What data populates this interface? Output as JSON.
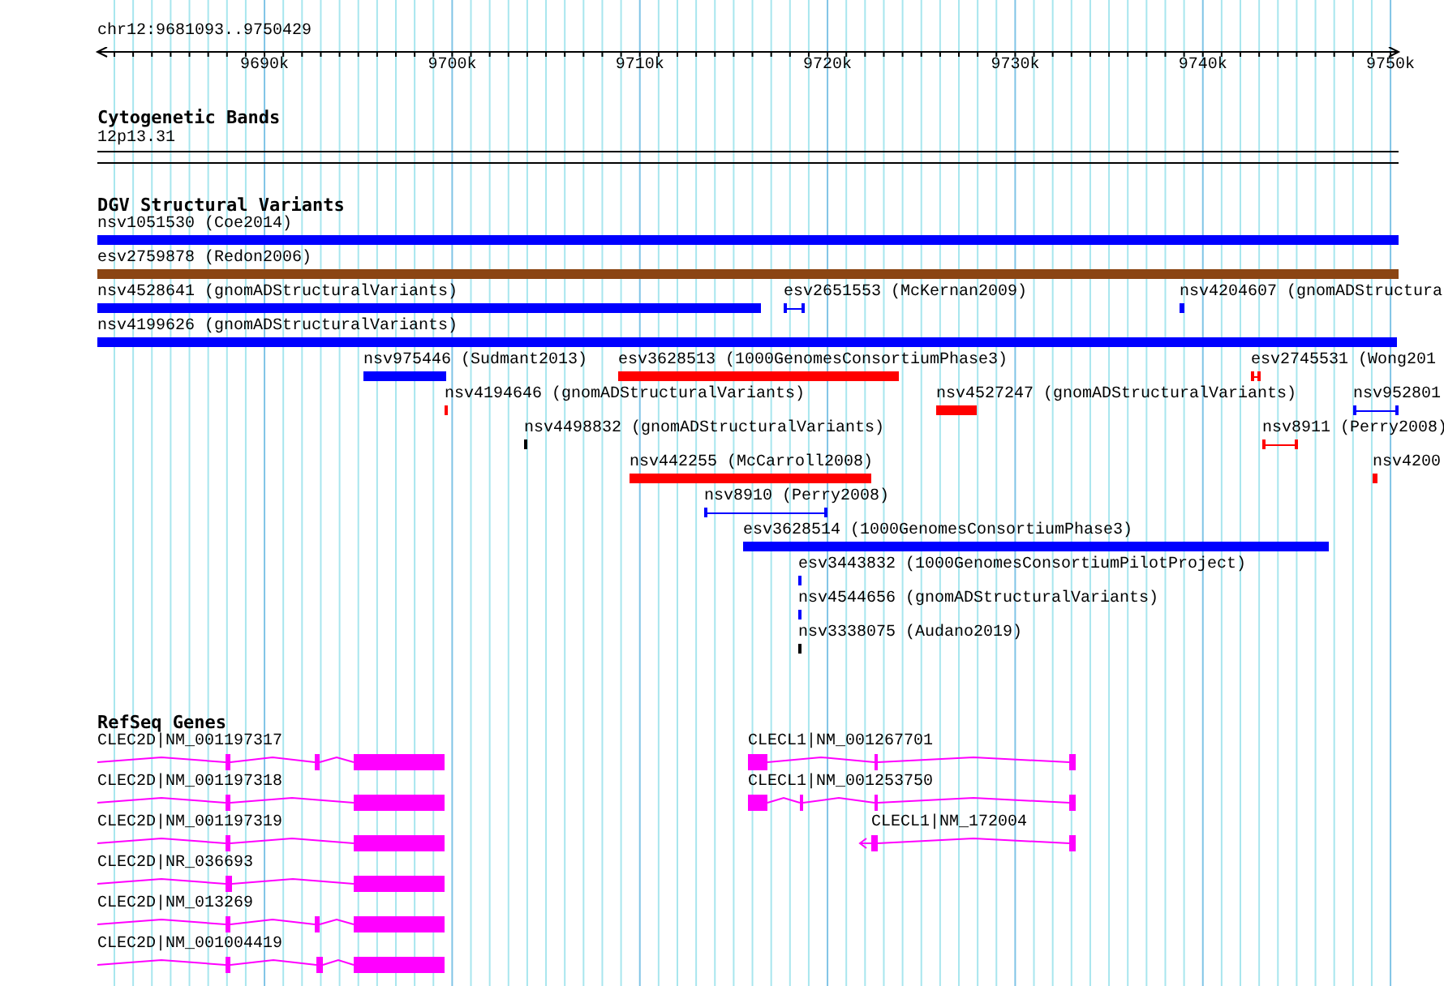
{
  "ruler": {
    "location": "chr12:9681093..9750429",
    "ticks": [
      {
        "label": "9690k"
      },
      {
        "label": "9700k"
      },
      {
        "label": "9710k"
      },
      {
        "label": "9720k"
      },
      {
        "label": "9730k"
      },
      {
        "label": "9740k"
      },
      {
        "label": "9750k"
      }
    ]
  },
  "cytogenetic_bands": {
    "title": "Cytogenetic Bands",
    "band": "12p13.31"
  },
  "dgv_structural_variants": {
    "title": "DGV Structural Variants",
    "rows": [
      [
        {
          "label": "nsv1051530 (Coe2014)",
          "kind": "bar",
          "color": "#0000ff"
        }
      ],
      [
        {
          "label": "esv2759878 (Redon2006)",
          "kind": "bar",
          "color": "#8b4513"
        }
      ],
      [
        {
          "label": "nsv4528641 (gnomADStructuralVariants)",
          "kind": "bar",
          "color": "#0000ff"
        },
        {
          "label": "esv2651553 (McKernan2009)",
          "kind": "range",
          "color": "#0000ff"
        },
        {
          "label": "nsv4204607 (gnomADStructura",
          "kind": "bar",
          "color": "#0000ff"
        }
      ],
      [
        {
          "label": "nsv4199626 (gnomADStructuralVariants)",
          "kind": "bar",
          "color": "#0000ff"
        }
      ],
      [
        {
          "label": "nsv975446 (Sudmant2013)",
          "kind": "bar",
          "color": "#0000ff"
        },
        {
          "label": "esv3628513 (1000GenomesConsortiumPhase3)",
          "kind": "bar",
          "color": "#ff0000"
        },
        {
          "label": "esv2745531 (Wong201",
          "kind": "range",
          "color": "#ff0000"
        }
      ],
      [
        {
          "label": "nsv4194646 (gnomADStructuralVariants)",
          "kind": "bar",
          "color": "#ff0000"
        },
        {
          "label": "nsv4527247 (gnomADStructuralVariants)",
          "kind": "bar",
          "color": "#ff0000"
        },
        {
          "label": "nsv952801",
          "kind": "range",
          "color": "#0000ff"
        }
      ],
      [
        {
          "label": "nsv4498832 (gnomADStructuralVariants)",
          "kind": "bar",
          "color": "#000000"
        },
        {
          "label": "nsv8911 (Perry2008)",
          "kind": "range",
          "color": "#ff0000"
        }
      ],
      [
        {
          "label": "nsv442255 (McCarroll2008)",
          "kind": "bar",
          "color": "#ff0000"
        },
        {
          "label": "nsv4200",
          "kind": "bar",
          "color": "#ff0000"
        }
      ],
      [
        {
          "label": "nsv8910 (Perry2008)",
          "kind": "range",
          "color": "#0000ff"
        }
      ],
      [
        {
          "label": "esv3628514 (1000GenomesConsortiumPhase3)",
          "kind": "bar",
          "color": "#0000ff"
        }
      ],
      [
        {
          "label": "esv3443832 (1000GenomesConsortiumPilotProject)",
          "kind": "bar",
          "color": "#0000ff"
        }
      ],
      [
        {
          "label": "nsv4544656 (gnomADStructuralVariants)",
          "kind": "bar",
          "color": "#0000ff"
        }
      ],
      [
        {
          "label": "nsv3338075 (Audano2019)",
          "kind": "bar",
          "color": "#000000"
        }
      ]
    ]
  },
  "refseq_genes": {
    "title": "RefSeq Genes",
    "rows": [
      [
        {
          "label": "CLEC2D|NM_001197317",
          "strand_arrow": false
        },
        {
          "label": "CLECL1|NM_001267701",
          "strand_arrow": false
        }
      ],
      [
        {
          "label": "CLEC2D|NM_001197318",
          "strand_arrow": false
        },
        {
          "label": "CLECL1|NM_001253750",
          "strand_arrow": false
        }
      ],
      [
        {
          "label": "CLEC2D|NM_001197319",
          "strand_arrow": false
        },
        {
          "label": "CLECL1|NM_172004",
          "strand_arrow": true
        }
      ],
      [
        {
          "label": "CLEC2D|NR_036693",
          "strand_arrow": false
        }
      ],
      [
        {
          "label": "CLEC2D|NM_013269",
          "strand_arrow": false
        }
      ],
      [
        {
          "label": "CLEC2D|NM_001004419",
          "strand_arrow": false
        }
      ]
    ]
  }
}
